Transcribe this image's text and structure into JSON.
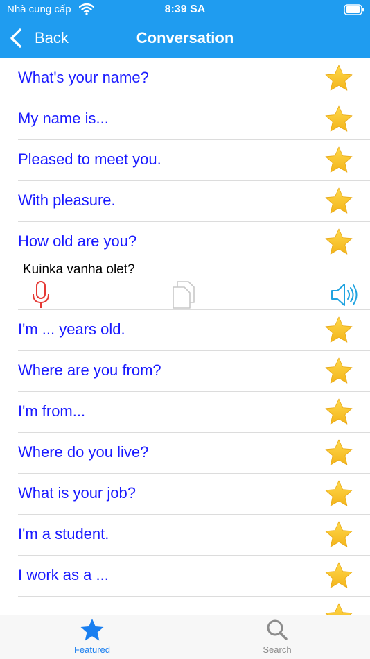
{
  "status_bar": {
    "carrier": "Nhà cung cấp",
    "time": "8:39 SA"
  },
  "nav": {
    "back_label": "Back",
    "title": "Conversation"
  },
  "phrases": [
    {
      "text": "What's your name?",
      "favorite": true
    },
    {
      "text": "My name is...",
      "favorite": true
    },
    {
      "text": "Pleased to meet you.",
      "favorite": true
    },
    {
      "text": "With pleasure.",
      "favorite": true
    },
    {
      "text": "How old are you?",
      "favorite": true,
      "translation": "Kuinka vanha olet?"
    },
    {
      "text": "I'm ... years old.",
      "favorite": true
    },
    {
      "text": "Where are you from?",
      "favorite": true
    },
    {
      "text": "I'm from...",
      "favorite": true
    },
    {
      "text": "Where do you live?",
      "favorite": true
    },
    {
      "text": "What is your job?",
      "favorite": true
    },
    {
      "text": "I'm a student.",
      "favorite": true
    },
    {
      "text": "I work as a ...",
      "favorite": true
    }
  ],
  "tabs": {
    "featured_label": "Featured",
    "search_label": "Search"
  },
  "colors": {
    "header": "#1f9cf0",
    "phrase_text": "#1a1aff",
    "star": "#f5c518",
    "mic": "#e53935",
    "speaker": "#1fa3e0",
    "tab_active": "#1a7ff0",
    "tab_inactive": "#8c8c8c"
  },
  "icons": {
    "favorite": "star-icon",
    "record": "microphone-icon",
    "copy": "copy-icon",
    "play": "speaker-icon",
    "featured": "star-icon",
    "search": "magnifier-icon"
  }
}
